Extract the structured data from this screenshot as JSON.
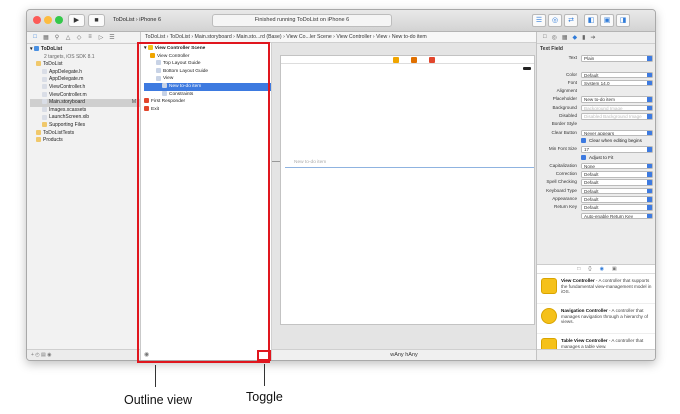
{
  "toolbar": {
    "scheme_target": "ToDoList",
    "scheme_device": "iPhone 6",
    "status_text": "Finished running ToDoList on iPhone 6"
  },
  "navigator": {
    "project": "ToDoList",
    "project_sub": "2 targets, iOS SDK 8.1",
    "items": [
      {
        "label": "ToDoList",
        "level": 1,
        "kind": "folder"
      },
      {
        "label": "AppDelegate.h",
        "level": 2,
        "kind": "file"
      },
      {
        "label": "AppDelegate.m",
        "level": 2,
        "kind": "file"
      },
      {
        "label": "ViewController.h",
        "level": 2,
        "kind": "file"
      },
      {
        "label": "ViewController.m",
        "level": 2,
        "kind": "file"
      },
      {
        "label": "Main.storyboard",
        "level": 2,
        "kind": "file",
        "selected": true,
        "badge": "M"
      },
      {
        "label": "Images.xcassets",
        "level": 2,
        "kind": "file"
      },
      {
        "label": "LaunchScreen.xib",
        "level": 2,
        "kind": "file"
      },
      {
        "label": "Supporting Files",
        "level": 2,
        "kind": "folder"
      },
      {
        "label": "ToDoListTests",
        "level": 1,
        "kind": "folder"
      },
      {
        "label": "Products",
        "level": 1,
        "kind": "folder"
      }
    ]
  },
  "jumpbar": {
    "crumbs": [
      "ToDoList",
      "ToDoList",
      "Main.storyboard",
      "Main.sto...rd (Base)",
      "View Co...ler Scene",
      "View Controller",
      "View",
      "New to-do item"
    ]
  },
  "outline": {
    "scene": "View Controller Scene",
    "items": [
      {
        "label": "View Controller",
        "level": 1
      },
      {
        "label": "Top Layout Guide",
        "level": 2
      },
      {
        "label": "Bottom Layout Guide",
        "level": 2
      },
      {
        "label": "View",
        "level": 2
      },
      {
        "label": "New to-do item",
        "level": 3,
        "selected": true
      },
      {
        "label": "Constraints",
        "level": 3
      },
      {
        "label": "First Responder",
        "level": 0
      },
      {
        "label": "Exit",
        "level": 0
      }
    ]
  },
  "canvas": {
    "textfield_placeholder": "New to-do item",
    "size_class": "wAny hAny"
  },
  "inspector": {
    "title": "Text Field",
    "rows": [
      {
        "label": "Text",
        "value": "Plain"
      },
      {
        "label": "",
        "value": ""
      },
      {
        "label": "Color",
        "value": "Default"
      },
      {
        "label": "Font",
        "value": "System 14.0"
      },
      {
        "label": "Alignment",
        "value": ""
      },
      {
        "label": "Placeholder",
        "value": "New to-do item"
      },
      {
        "label": "Background",
        "value": "Background Image",
        "dim": true
      },
      {
        "label": "Disabled",
        "value": "Disabled Background Image",
        "dim": true
      },
      {
        "label": "Border Style",
        "value": ""
      },
      {
        "label": "Clear Button",
        "value": "Never appears"
      },
      {
        "label": "",
        "value": "Clear when editing begins",
        "check": true
      },
      {
        "label": "Min Font Size",
        "value": "17"
      },
      {
        "label": "",
        "value": "Adjust to Fit",
        "check": true
      },
      {
        "label": "Capitalization",
        "value": "None"
      },
      {
        "label": "Correction",
        "value": "Default"
      },
      {
        "label": "Spell Checking",
        "value": "Default"
      },
      {
        "label": "Keyboard Type",
        "value": "Default"
      },
      {
        "label": "Appearance",
        "value": "Default"
      },
      {
        "label": "Return Key",
        "value": "Default"
      },
      {
        "label": "",
        "value": "Auto-enable Return Key"
      }
    ]
  },
  "library": [
    {
      "title": "View Controller",
      "desc": "- A controller that supports the fundamental view-management model in iOS."
    },
    {
      "title": "Navigation Controller",
      "desc": "- A controller that manages navigation through a hierarchy of views."
    },
    {
      "title": "Table View Controller",
      "desc": "- A controller that manages a table view."
    }
  ],
  "annotations": {
    "outline_label": "Outline view",
    "toggle_label": "Toggle"
  },
  "colors": {
    "highlight": "#e0161e",
    "accent": "#3d7ae0"
  }
}
